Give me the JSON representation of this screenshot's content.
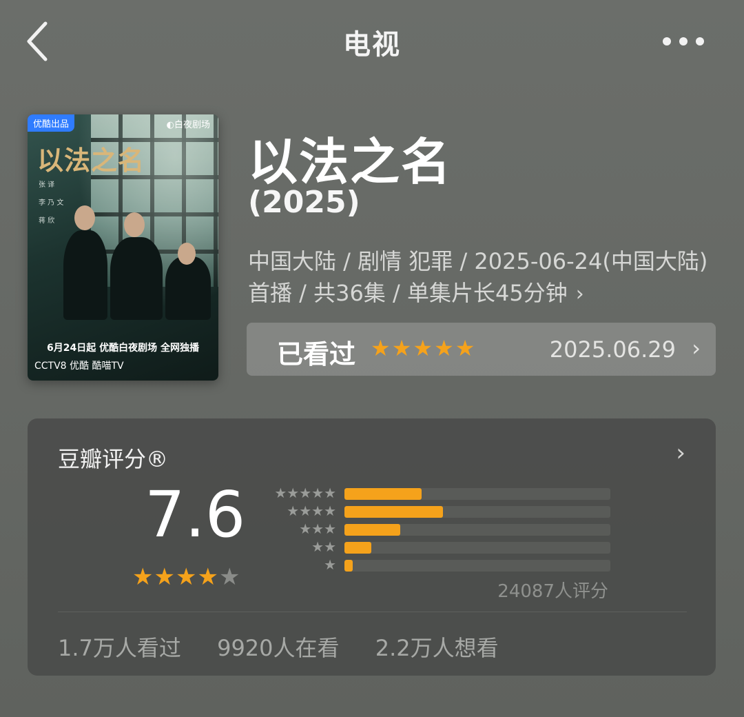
{
  "header": {
    "title": "电视"
  },
  "poster": {
    "badge": "优酷出品",
    "logo": "◐白夜剧场",
    "title_art": "以法之名",
    "cast": [
      "张 译",
      "李 乃 文",
      "蒋 欣"
    ],
    "date_line": "6月24日起 优酷白夜剧场 全网独播",
    "platforms": "CCTV8  优酷  酷喵TV"
  },
  "show": {
    "title": "以法之名",
    "year": "(2025)",
    "meta": "中国大陆 / 剧情 犯罪 / 2025-06-24(中国大陆)首播 / 共36集 / 单集片长45分钟"
  },
  "watched": {
    "label": "已看过",
    "stars": 5,
    "date": "2025.06.29"
  },
  "rating": {
    "title": "豆瓣评分®",
    "score": "7.6",
    "score_stars": 4,
    "distribution": [
      {
        "stars": 5,
        "fraction": 0.29
      },
      {
        "stars": 4,
        "fraction": 0.37
      },
      {
        "stars": 3,
        "fraction": 0.21
      },
      {
        "stars": 2,
        "fraction": 0.1
      },
      {
        "stars": 1,
        "fraction": 0.03
      }
    ],
    "count_label": "24087人评分",
    "stats": [
      "1.7万人看过",
      "9920人在看",
      "2.2万人想看"
    ]
  },
  "colors": {
    "accent": "#f5a21b",
    "badge": "#2f7cff"
  }
}
